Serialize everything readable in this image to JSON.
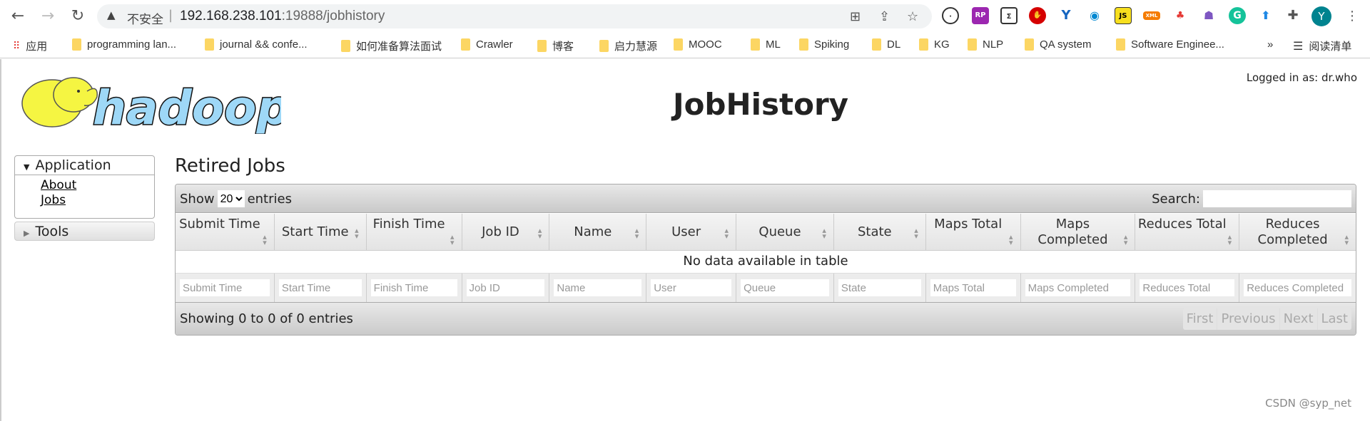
{
  "browser": {
    "insecure_label": "不安全",
    "url_host": "192.168.238.101",
    "url_rest": ":19888/jobhistory",
    "avatar_letter": "Y",
    "bookmarks": [
      "应用",
      "programming lan...",
      "journal && confe...",
      "如何准备算法面试",
      "Crawler",
      "博客",
      "启力慧源",
      "MOOC",
      "ML",
      "Spiking",
      "DL",
      "KG",
      "NLP",
      "QA system",
      "Software Enginee..."
    ],
    "reading_list": "阅读清单",
    "more": "»"
  },
  "header": {
    "logo_text": "hadoop",
    "title": "JobHistory",
    "logged_in": "Logged in as: dr.who"
  },
  "sidebar": {
    "application": "Application",
    "links": [
      "About",
      "Jobs"
    ],
    "tools": "Tools"
  },
  "main": {
    "heading": "Retired Jobs",
    "show": "Show",
    "entries_value": "20",
    "entries": "entries",
    "search_label": "Search:",
    "columns": [
      "Submit Time",
      "Start Time",
      "Finish Time",
      "Job ID",
      "Name",
      "User",
      "Queue",
      "State",
      "Maps Total",
      "Maps Completed",
      "Reduces Total",
      "Reduces Completed"
    ],
    "filter_placeholders": [
      "Submit Time",
      "Start Time",
      "Finish Time",
      "Job ID",
      "Name",
      "User",
      "Queue",
      "State",
      "Maps Total",
      "Maps Completed",
      "Reduces Total",
      "Reduces Completed"
    ],
    "empty": "No data available in table",
    "info": "Showing 0 to 0 of 0 entries",
    "pager": [
      "First",
      "Previous",
      "Next",
      "Last"
    ]
  },
  "watermark": "CSDN @syp_net"
}
